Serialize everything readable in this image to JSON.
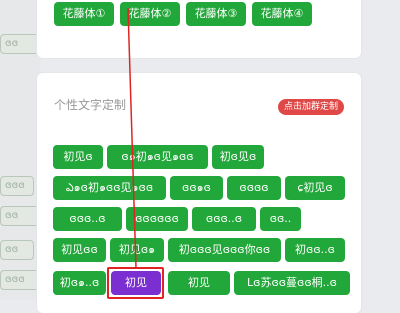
{
  "top_font_buttons": [
    "花藤体①",
    "花藤体②",
    "花藤体③",
    "花藤体④"
  ],
  "section": {
    "title": "个性文字定制",
    "badge": "点击加群定制"
  },
  "text_buttons": [
    "初见ɞ",
    "ɞ๑初๑ɞ见๑ɞɞ",
    "初ɞ见ɞ",
    "ఎ๑ɞ初๑ɞɞ见๑ɞɞ",
    "ɞɞ๑ɞ",
    "ɞɞɞɞ",
    "ɕ初见ɞ",
    "ɞɞɞ..ɞ",
    "ɞɞɞɞɞɞ",
    "ɞɞɞ..ɞ",
    "ɞɞ..",
    "初见ɞɞ",
    "初见ɞ๑",
    "初ɞɞɞ见ɞɞɞ你ɞɞ",
    "初ɞɞ..ɞ",
    "初ɞ๑..ɞ",
    "初见",
    "初见",
    "Lɞ苏ɞɞ蔓ɞɞ桐..ɞ"
  ],
  "selected_label": "初见",
  "background_chips": [
    "ɞɞ",
    "ɞɞɞ",
    "ɞɞ",
    "ɞɞ",
    "ɞɞɞ",
    "ɞɞ"
  ]
}
